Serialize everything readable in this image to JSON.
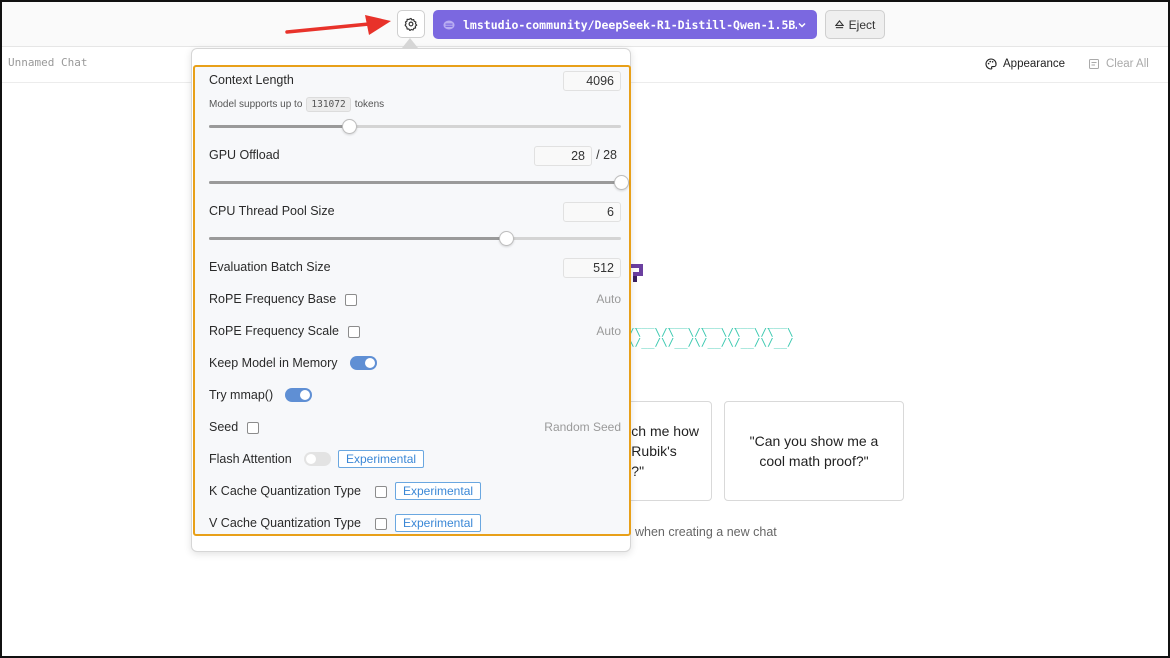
{
  "toolbar": {
    "model_name": "lmstudio-community/DeepSeek-R1-Distill-Qwen-1.5B…",
    "eject_label": "Eject"
  },
  "chat": {
    "title": "Unnamed Chat",
    "appearance_label": "Appearance",
    "clear_all_label": "Clear All"
  },
  "background": {
    "card1_text": "ch me how\nRubik's\n?\"",
    "card2_text": "\"Can you show me a cool math proof?\"",
    "hint_text": "when creating a new chat"
  },
  "settings": {
    "context_length": {
      "label": "Context Length",
      "value": "4096",
      "note_prefix": "Model supports up to",
      "max_tokens": "131072",
      "note_suffix": "tokens",
      "slider_fraction": 0.34
    },
    "gpu_offload": {
      "label": "GPU Offload",
      "value": "28",
      "max": "/ 28",
      "slider_fraction": 1.0
    },
    "cpu_thread_pool": {
      "label": "CPU Thread Pool Size",
      "value": "6",
      "slider_fraction": 0.72
    },
    "eval_batch": {
      "label": "Evaluation Batch Size",
      "value": "512"
    },
    "rope_base": {
      "label": "RoPE Frequency Base",
      "value": "Auto"
    },
    "rope_scale": {
      "label": "RoPE Frequency Scale",
      "value": "Auto"
    },
    "keep_in_memory": {
      "label": "Keep Model in Memory",
      "enabled": true
    },
    "mmap": {
      "label": "Try mmap()",
      "enabled": true
    },
    "seed": {
      "label": "Seed",
      "value": "Random Seed"
    },
    "flash_attention": {
      "label": "Flash Attention",
      "enabled": false,
      "badge": "Experimental"
    },
    "k_cache": {
      "label": "K Cache Quantization Type",
      "badge": "Experimental"
    },
    "v_cache": {
      "label": "V Cache Quantization Type",
      "badge": "Experimental"
    }
  },
  "colors": {
    "accent": "#7b68e0",
    "highlight_border": "#e8a019",
    "arrow": "#e8322a",
    "toggle_on": "#5f8fd4",
    "badge": "#3a87d6"
  }
}
